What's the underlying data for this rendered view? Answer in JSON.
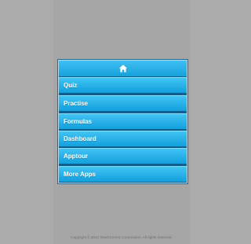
{
  "menu": {
    "home_icon": "home-icon",
    "items": [
      {
        "label": "Quiz"
      },
      {
        "label": "Practise"
      },
      {
        "label": "Formulas"
      },
      {
        "label": "Dashboard"
      },
      {
        "label": "Apptour"
      },
      {
        "label": "More Apps"
      }
    ]
  },
  "footer": {
    "copyright": "Copyright © 2012 TeachCentric Corporation. All rights reserved."
  },
  "colors": {
    "background": "#ababab",
    "menu_item_top": "#41c3f3",
    "menu_item_bottom": "#13a0dd",
    "menu_border": "#1b6f9f",
    "text": "#ffffff"
  }
}
